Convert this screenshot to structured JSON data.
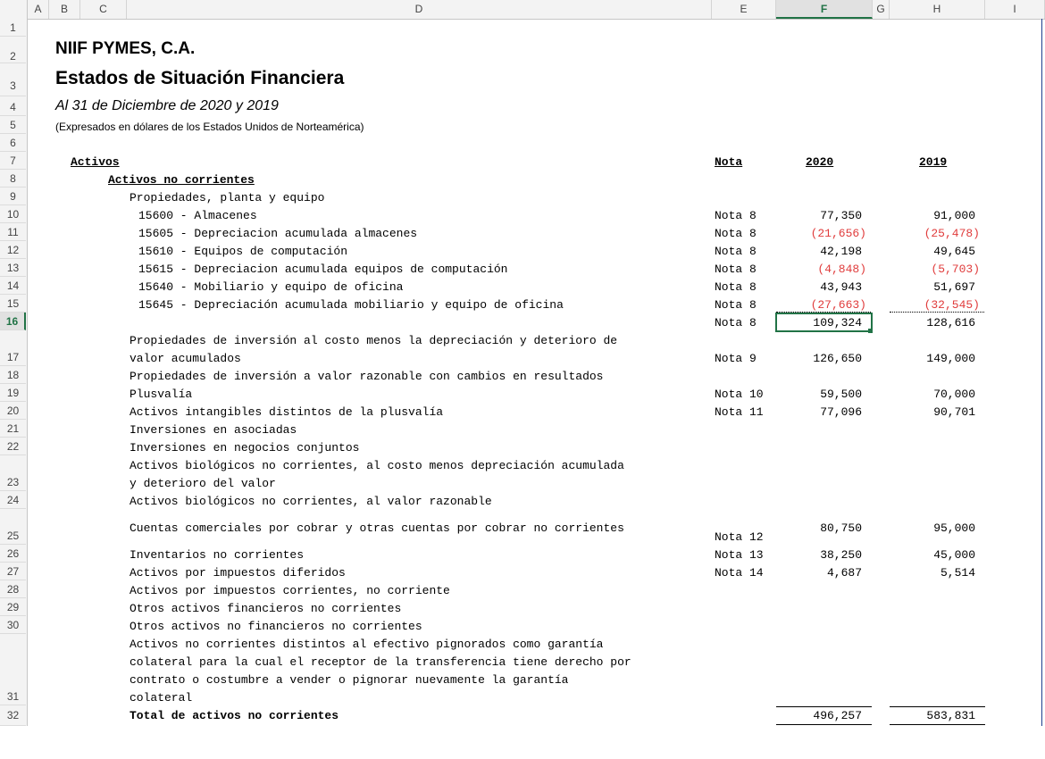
{
  "columns": [
    "A",
    "B",
    "C",
    "D",
    "E",
    "F",
    "G",
    "H",
    "I"
  ],
  "selected_column": "F",
  "selected_row": "16",
  "rows": [
    "1",
    "2",
    "3",
    "4",
    "5",
    "6",
    "7",
    "8",
    "9",
    "10",
    "11",
    "12",
    "13",
    "14",
    "15",
    "16",
    "17",
    "18",
    "19",
    "20",
    "21",
    "22",
    "23",
    "24",
    "25",
    "26",
    "27",
    "28",
    "29",
    "30",
    "31",
    "32"
  ],
  "report": {
    "company": "NIIF PYMES, C.A.",
    "title": "Estados de Situación Financiera",
    "period": "Al 31 de Diciembre de 2020 y 2019",
    "currency_note": "(Expresados en dólares de los Estados Unidos de Norteamérica)"
  },
  "headers": {
    "section": "Activos",
    "subsection": "Activos no corrientes",
    "note": "Nota",
    "year1": "2020",
    "year2": "2019"
  },
  "ppe": {
    "label": "Propiedades, planta y equipo",
    "items": [
      {
        "label": "15600 - Almacenes",
        "note": "Nota 8",
        "v2020": "77,350",
        "v2019": "91,000"
      },
      {
        "label": "15605 - Depreciacion acumulada almacenes",
        "note": "Nota 8",
        "v2020": "(21,656)",
        "v2019": "(25,478)"
      },
      {
        "label": "15610 - Equipos de computación",
        "note": "Nota 8",
        "v2020": "42,198",
        "v2019": "49,645"
      },
      {
        "label": "15615 - Depreciacion acumulada equipos de computación",
        "note": "Nota 8",
        "v2020": "(4,848)",
        "v2019": "(5,703)"
      },
      {
        "label": "15640 - Mobiliario y equipo de oficina",
        "note": "Nota 8",
        "v2020": "43,943",
        "v2019": "51,697"
      },
      {
        "label": "15645 - Depreciación acumulada mobiliario y equipo de oficina",
        "note": "Nota 8",
        "v2020": "(27,663)",
        "v2019": "(32,545)"
      }
    ],
    "subtotal": {
      "note": "Nota 8",
      "v2020": "109,324",
      "v2019": "128,616"
    }
  },
  "lines": {
    "r17a": "Propiedades de inversión al costo menos la depreciación y deterioro de",
    "r17b": "valor acumulados",
    "r17_note": "Nota 9",
    "r17_2020": "126,650",
    "r17_2019": "149,000",
    "r18": "Propiedades de inversión a valor razonable con cambios en resultados",
    "r19": "Plusvalía",
    "r19_note": "Nota 10",
    "r19_2020": "59,500",
    "r19_2019": "70,000",
    "r20": "Activos intangibles distintos de la plusvalía",
    "r20_note": "Nota 11",
    "r20_2020": "77,096",
    "r20_2019": "90,701",
    "r21": "Inversiones en asociadas",
    "r22": "Inversiones en negocios conjuntos",
    "r23a": "Activos biológicos no corrientes, al costo menos depreciación acumulada",
    "r23b": "y deterioro del valor",
    "r24": "Activos biológicos no corrientes, al valor razonable",
    "r25": "Cuentas comerciales por cobrar y otras cuentas por cobrar no corrientes",
    "r25_note": "Nota 12",
    "r25_2020": "80,750",
    "r25_2019": "95,000",
    "r26": "Inventarios no corrientes",
    "r26_note": "Nota 13",
    "r26_2020": "38,250",
    "r26_2019": "45,000",
    "r27": "Activos por impuestos diferidos",
    "r27_note": "Nota 14",
    "r27_2020": "4,687",
    "r27_2019": "5,514",
    "r28": "Activos por impuestos corrientes, no corriente",
    "r29": "Otros activos financieros no corrientes",
    "r30": "Otros activos no financieros no corrientes",
    "r31a": "Activos no corrientes distintos al efectivo pignorados como garantía",
    "r31b": "colateral para la cual el receptor de la transferencia tiene derecho por",
    "r31c": "contrato o costumbre a vender o pignorar nuevamente la garantía",
    "r31d": "colateral",
    "r32": "Total de activos no corrientes",
    "r32_2020": "496,257",
    "r32_2019": "583,831"
  }
}
